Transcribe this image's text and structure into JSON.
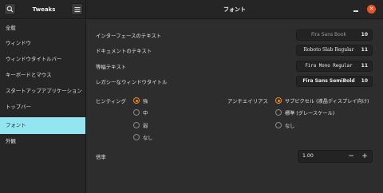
{
  "header": {
    "app_title": "Tweaks",
    "page_title": "フォント",
    "close_glyph": "✕"
  },
  "sidebar": {
    "items": [
      {
        "label": "全般"
      },
      {
        "label": "ウィンドウ"
      },
      {
        "label": "ウィンドウタイトルバー"
      },
      {
        "label": "キーボードとマウス"
      },
      {
        "label": "スタートアップアプリケーション"
      },
      {
        "label": "トップバー"
      },
      {
        "label": "フォント",
        "active": true
      },
      {
        "label": "外観"
      }
    ]
  },
  "fonts": {
    "interface": {
      "label": "インターフェースのテキスト",
      "font": "Fira Sans Book",
      "size": "10"
    },
    "document": {
      "label": "ドキュメントのテキスト",
      "font": "Roboto Slab Regular",
      "size": "11"
    },
    "monospace": {
      "label": "等幅テキスト",
      "font": "Fira Mono Regular",
      "size": "11"
    },
    "legacy_title": {
      "label": "レガシーなウィンドウタイトル",
      "font": "Fira Sans SemiBold",
      "size": "10"
    }
  },
  "hinting": {
    "label": "ヒンティング",
    "options": [
      "強",
      "中",
      "弱",
      "なし"
    ],
    "selected": "強"
  },
  "antialiasing": {
    "label": "アンチエイリアス",
    "options": [
      "サブピクセル (液晶ディスプレイ向け)",
      "標準 (グレースケール)",
      "なし"
    ],
    "selected": "サブピクセル (液晶ディスプレイ向け)"
  },
  "scaling": {
    "label": "倍率",
    "value": "1.00",
    "minus": "−",
    "plus": "+"
  },
  "colors": {
    "accent": "#f08a1c",
    "sidebar_active": "#93e6ef",
    "close_button": "#e95420"
  }
}
